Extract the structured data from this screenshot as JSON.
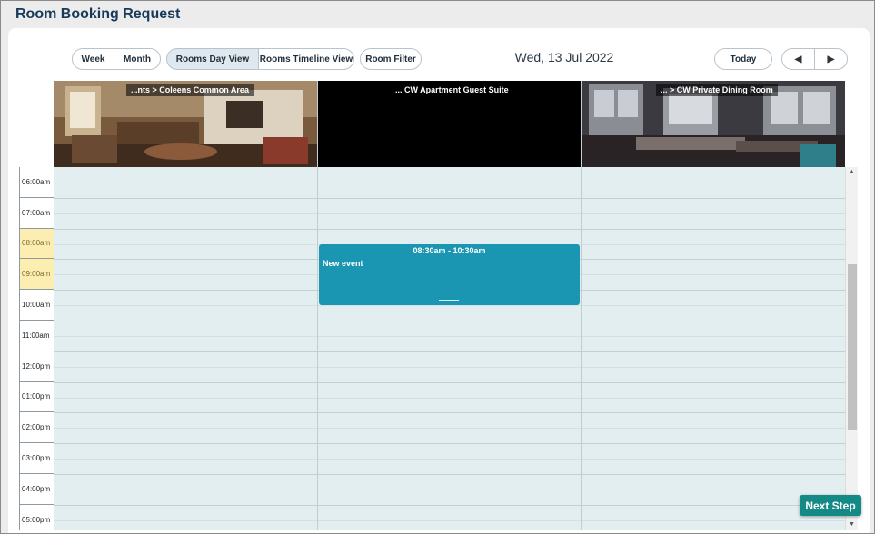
{
  "page": {
    "title": "Room Booking Request"
  },
  "toolbar": {
    "week": "Week",
    "month": "Month",
    "rooms_day_view": "Rooms Day View",
    "rooms_timeline_view": "Rooms Timeline View",
    "room_filter": "Room Filter",
    "date": "Wed, 13 Jul 2022",
    "today": "Today",
    "prev_icon": "◀",
    "next_icon": "▶"
  },
  "rooms": [
    {
      "label": "...nts > Coleens Common Area"
    },
    {
      "label": "... CW Apartment Guest Suite"
    },
    {
      "label": "... > CW Private Dining Room"
    }
  ],
  "times": [
    "06:00am",
    "07:00am",
    "08:00am",
    "09:00am",
    "10:00am",
    "11:00am",
    "12:00pm",
    "01:00pm",
    "02:00pm",
    "03:00pm",
    "04:00pm",
    "05:00pm"
  ],
  "event": {
    "time": "08:30am - 10:30am",
    "title": "New event"
  },
  "scrollbar": {
    "up_icon": "▲",
    "down_icon": "▼"
  },
  "next_step": "Next Step"
}
